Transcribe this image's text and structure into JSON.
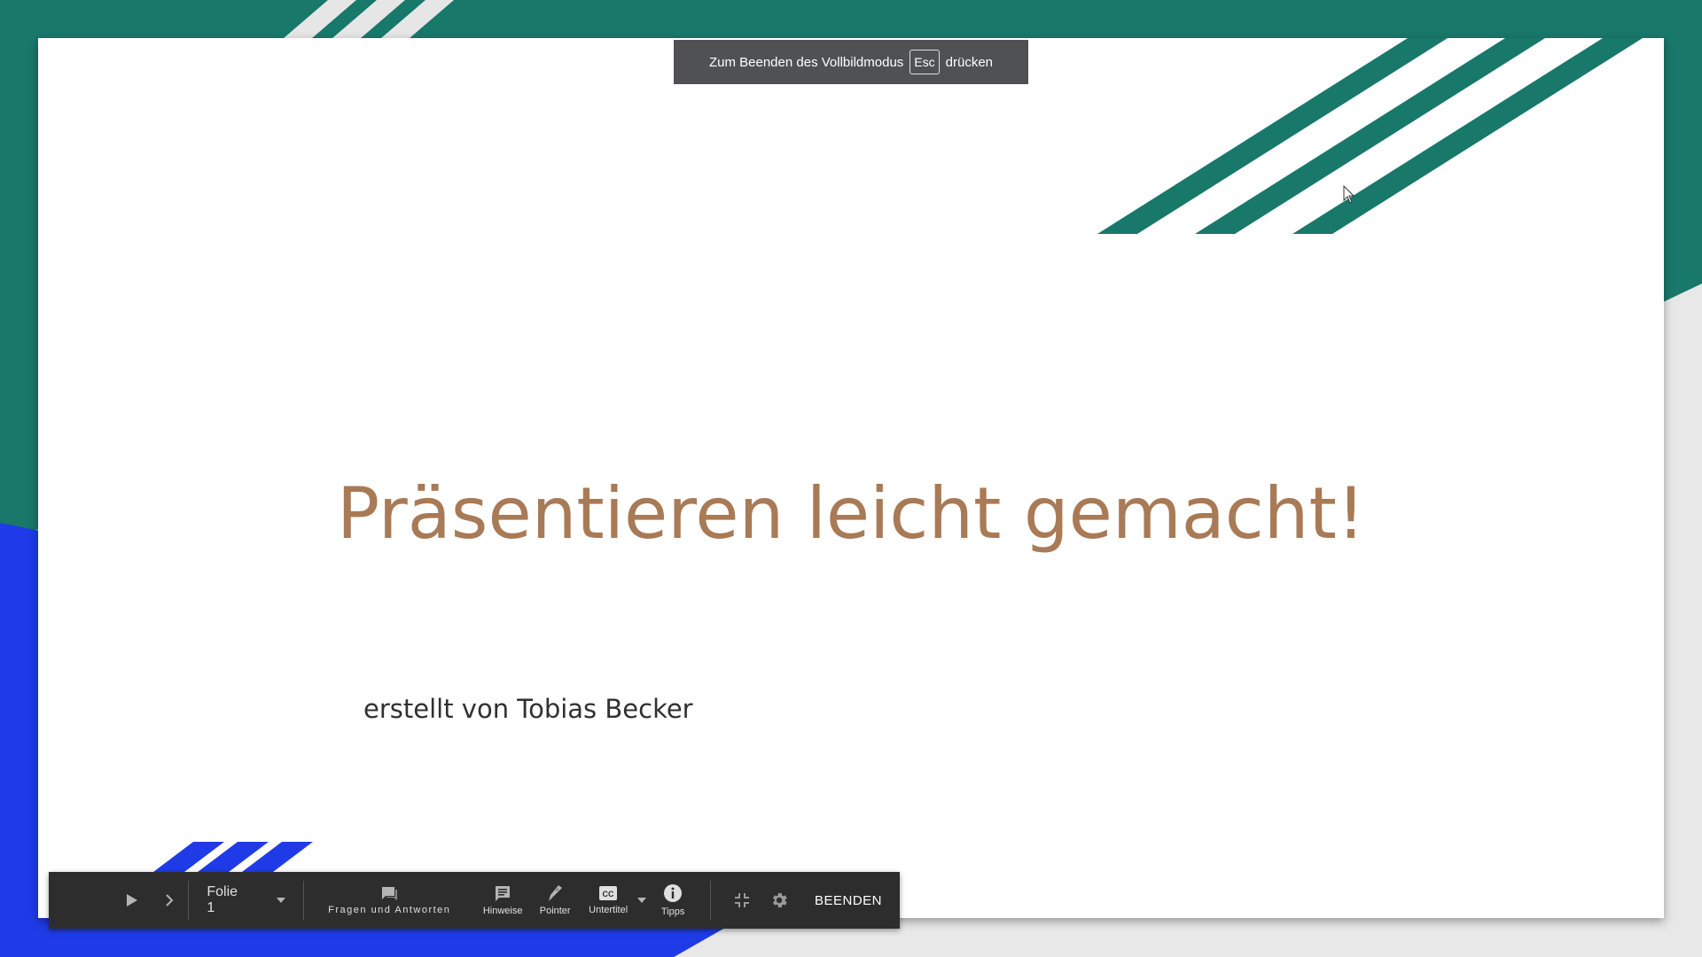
{
  "fullscreen_notice": {
    "text_before": "Zum Beenden des Vollbildmodus",
    "key": "Esc",
    "text_after": "drücken"
  },
  "slide": {
    "title": "Präsentieren leicht gemacht!",
    "subtitle": "erstellt von Tobias Becker"
  },
  "toolbar": {
    "slide_selector": "Folie 1",
    "qa_label": "Fragen und Antworten",
    "notes_label": "Hinweise",
    "pointer_label": "Pointer",
    "captions_label": "Untertitel",
    "tips_label": "Tipps",
    "end_label": "BEENDEN"
  },
  "colors": {
    "teal": "#18786a",
    "blue": "#1f3be8",
    "title": "#a87a56",
    "toolbar_bg": "#2d2d2d"
  },
  "icons": {
    "play": "play-icon",
    "next": "chevron-right-icon",
    "dropdown": "caret-down-icon",
    "qa": "chat-icon",
    "notes": "notes-icon",
    "pointer": "pointer-icon",
    "captions": "closed-captions-icon",
    "tips": "info-icon",
    "exit_fullscreen": "exit-fullscreen-icon",
    "settings": "gear-icon"
  }
}
